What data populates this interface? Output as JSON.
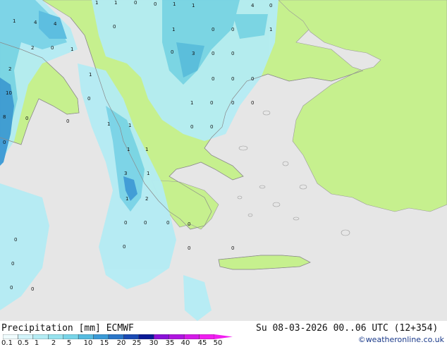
{
  "map": {
    "region": "Balkans / Aegean",
    "colors": {
      "sea": "#e6e6e6",
      "land": "#c6f08e",
      "precip_light": "#b4ecf4",
      "precip_mid": "#78d4e8",
      "precip_heavy": "#3a9ad6",
      "coast": "#9a9a9a"
    },
    "value_labels": [
      "1",
      "1",
      "0",
      "0",
      "1",
      "1",
      "4",
      "0",
      "1",
      "4",
      "4",
      "0",
      "1",
      "0",
      "0",
      "1",
      "2",
      "0",
      "1",
      "0",
      "3",
      "0",
      "0",
      "2",
      "1",
      "0",
      "0",
      "0",
      "0",
      "0",
      "10",
      "1",
      "0",
      "0",
      "0",
      "8",
      "0",
      "1",
      "1",
      "0",
      "0",
      "3",
      "1",
      "1",
      "2",
      "0",
      "1",
      "1",
      "0",
      "0",
      "0",
      "0",
      "0",
      "0",
      "0",
      "0",
      "0",
      "0",
      "0"
    ]
  },
  "footer": {
    "title": "Precipitation [mm] ECMWF",
    "datetime": "Su 08-03-2026 00..06 UTC (12+354)",
    "credit": "©weatheronline.co.uk",
    "legend_ticks": [
      "0.1",
      "0.5",
      "1",
      "2",
      "5",
      "10",
      "15",
      "20",
      "25",
      "30",
      "35",
      "40",
      "45",
      "50"
    ],
    "legend_colors": [
      "#f0fcfe",
      "#d2f4fa",
      "#b4ecf4",
      "#96e2ee",
      "#78d4e8",
      "#56bce0",
      "#3a9ad6",
      "#2a76c8",
      "#1a4ab4",
      "#0a1a96",
      "#8a10d8",
      "#b014e0",
      "#d41ae8",
      "#f01ef0"
    ]
  }
}
